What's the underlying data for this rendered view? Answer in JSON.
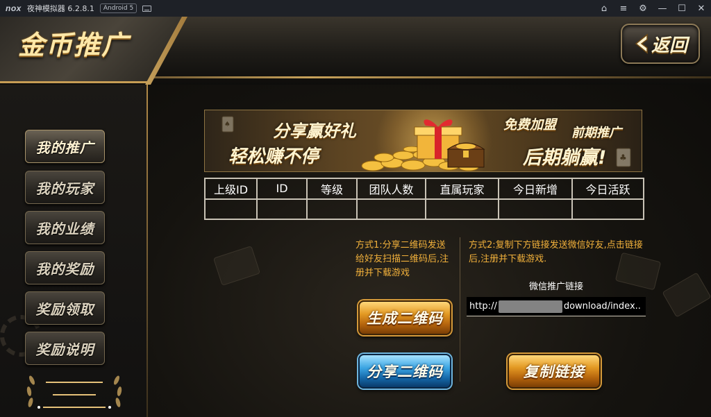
{
  "titlebar": {
    "logo": "nox",
    "app_name": "夜神模拟器 6.2.8.1",
    "android_badge": "Android 5",
    "icons": [
      "keyboard-icon",
      "shirt-icon",
      "menu-icon",
      "gear-icon",
      "minimize-icon",
      "maximize-icon",
      "close-icon"
    ],
    "glyphs": {
      "shirt": "⌂",
      "menu": "≡",
      "gear": "⚙",
      "minimize": "—",
      "maximize": "☐",
      "close": "✕"
    }
  },
  "header": {
    "title": "金币推广",
    "back_label": "返回"
  },
  "sidebar": {
    "items": [
      {
        "label": "我的推广",
        "active": true
      },
      {
        "label": "我的玩家",
        "active": false
      },
      {
        "label": "我的业绩",
        "active": false
      },
      {
        "label": "我的奖励",
        "active": false
      },
      {
        "label": "奖励领取",
        "active": false
      },
      {
        "label": "奖励说明",
        "active": false
      }
    ]
  },
  "banner": {
    "line1": "分享赢好礼",
    "line2": "轻松赚不停",
    "line3": "免费加盟",
    "line4": "前期推广",
    "line5": "后期躺赢!",
    "icons": [
      "gift-box-icon",
      "gold-coins-icon",
      "treasure-chest-icon",
      "playing-card-icon"
    ]
  },
  "stats_table": {
    "columns": [
      "上级ID",
      "ID",
      "等级",
      "团队人数",
      "直属玩家",
      "今日新增",
      "今日活跃"
    ],
    "rows": [
      [
        "",
        "",
        "",
        "",
        "",
        "",
        ""
      ]
    ]
  },
  "method1": {
    "text": "方式1:分享二维码发送给好友扫描二维码后,注册并下载游戏"
  },
  "method2": {
    "text": "方式2:复制下方链接发送微信好友,点击链接后,注册并下载游戏.",
    "link_caption": "微信推广链接",
    "link_prefix": "http://",
    "link_suffix": "download/index.."
  },
  "buttons": {
    "generate_qr": "生成二维码",
    "share_qr": "分享二维码",
    "copy_link": "复制链接"
  },
  "colors": {
    "accent_gold": "#c8a25a",
    "method_text": "#f2b13b",
    "table_border": "#c9c3b6",
    "titlebar_bg": "#1e2127"
  }
}
